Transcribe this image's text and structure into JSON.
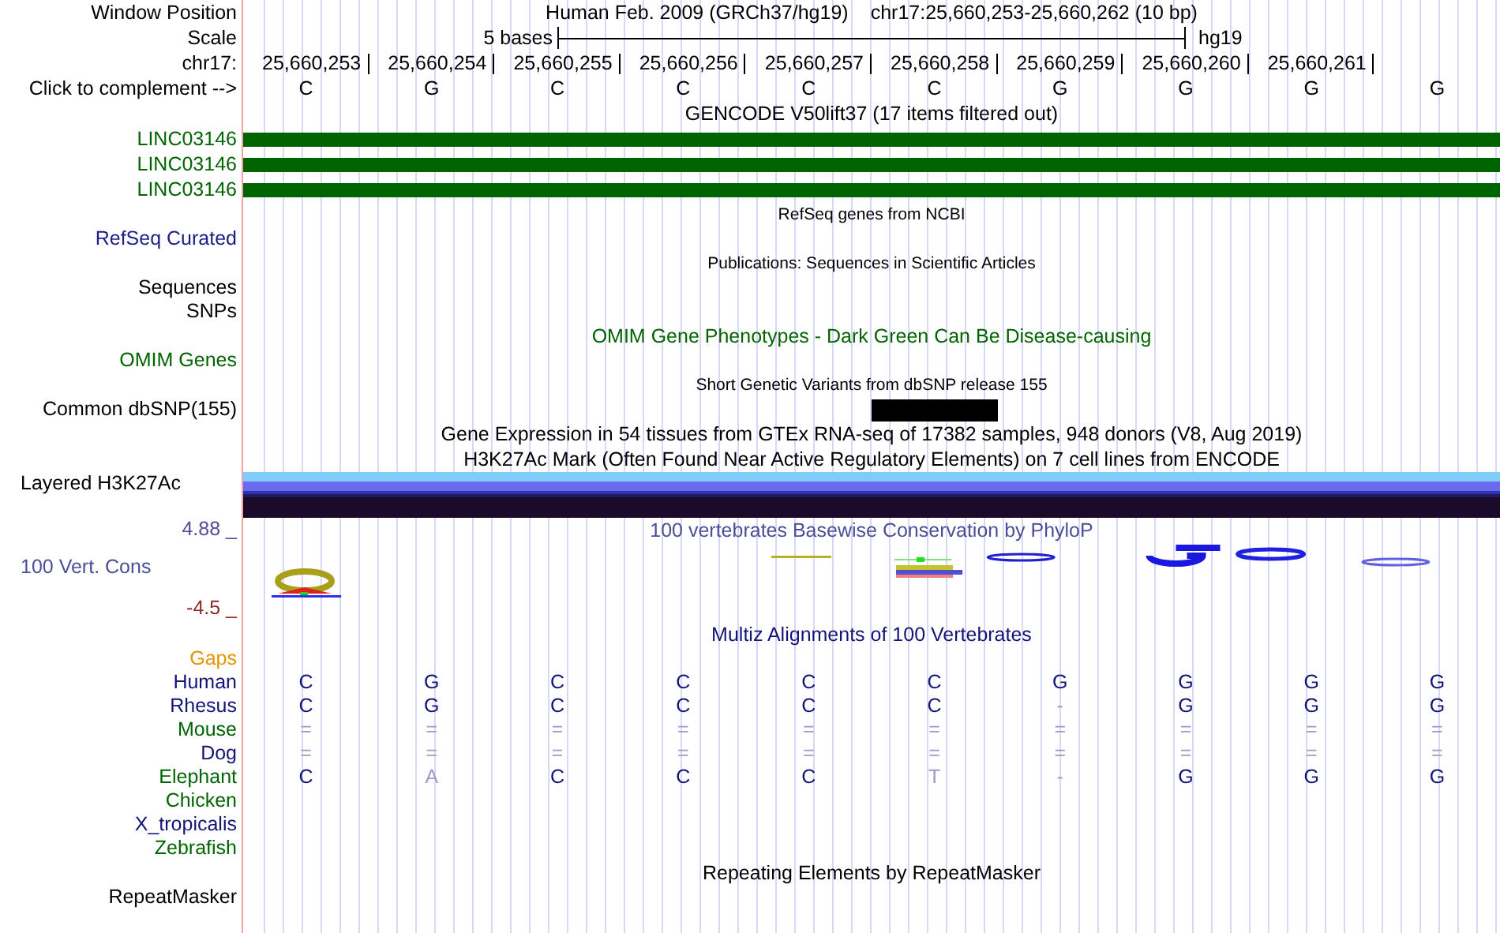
{
  "lines": [
    {
      "kind": "position",
      "label": "Window Position",
      "text": "Human Feb. 2009 (GRCh37/hg19)",
      "range": "chr17:25,660,253-25,660,262 (10 bp)"
    },
    {
      "kind": "scale",
      "label": "Scale",
      "text": "5 bases",
      "assembly": "hg19"
    },
    {
      "kind": "ruler",
      "label": "chr17:",
      "ticks": [
        "25,660,253",
        "25,660,254",
        "25,660,255",
        "25,660,256",
        "25,660,257",
        "25,660,258",
        "25,660,259",
        "25,660,260",
        "25,660,261"
      ]
    },
    {
      "kind": "bases",
      "label": "Click to complement -->",
      "bases": [
        "C",
        "G",
        "C",
        "C",
        "C",
        "C",
        "G",
        "G",
        "G",
        "G"
      ]
    },
    {
      "kind": "title",
      "text": "GENCODE V50lift37 (17 items filtered out)",
      "color": "#000000"
    },
    {
      "kind": "gene",
      "label": "LINC03146",
      "color": "#006400"
    },
    {
      "kind": "gene",
      "label": "LINC03146",
      "color": "#006400"
    },
    {
      "kind": "gene",
      "label": "LINC03146",
      "color": "#006400"
    },
    {
      "kind": "small-title",
      "text": "RefSeq genes from NCBI"
    },
    {
      "kind": "label",
      "label": "RefSeq Curated",
      "color": "#1c1c8a"
    },
    {
      "kind": "small-title",
      "text": "Publications: Sequences in Scientific Articles"
    },
    {
      "kind": "label",
      "label": "Sequences",
      "color": "#000000"
    },
    {
      "kind": "label",
      "label": "SNPs",
      "color": "#000000"
    },
    {
      "kind": "title",
      "text": "OMIM Gene Phenotypes - Dark Green Can Be Disease-causing",
      "color": "#006400"
    },
    {
      "kind": "label",
      "label": "OMIM Genes",
      "color": "#006400"
    },
    {
      "kind": "small-title",
      "text": "Short Genetic Variants from dbSNP release 155"
    },
    {
      "kind": "variants",
      "label": "Common dbSNP(155)",
      "color": "#000000",
      "variant_at_base": [
        false,
        false,
        false,
        false,
        false,
        true,
        false,
        false,
        false,
        false
      ]
    },
    {
      "kind": "title",
      "text": "Gene Expression in 54 tissues from GTEx RNA-seq of 17382 samples, 948 donors (V8, Aug 2019)",
      "color": "#000000"
    },
    {
      "kind": "title",
      "text": "H3K27Ac Mark (Often Found Near Active Regulatory Elements) on 7 cell lines from ENCODE",
      "color": "#000000"
    },
    {
      "kind": "signal",
      "label": "Layered H3K27Ac",
      "color": "#000000"
    },
    {
      "kind": "conservation",
      "title": "100 vertebrates Basewise Conservation by PhyloP",
      "max": "4.88 _",
      "label": "100 Vert. Cons",
      "min": "-4.5 _",
      "color": "#4d4d99"
    },
    {
      "kind": "title",
      "text": "Multiz Alignments of 100 Vertebrates",
      "color": "#141478"
    },
    {
      "kind": "label",
      "label": "Gaps",
      "color": "#e69500"
    },
    {
      "kind": "alignment",
      "label": "Human",
      "color": "#141478",
      "bases": [
        {
          "text": "C",
          "faded": false
        },
        {
          "text": "G",
          "faded": false
        },
        {
          "text": "C",
          "faded": false
        },
        {
          "text": "C",
          "faded": false
        },
        {
          "text": "C",
          "faded": false
        },
        {
          "text": "C",
          "faded": false
        },
        {
          "text": "G",
          "faded": false
        },
        {
          "text": "G",
          "faded": false
        },
        {
          "text": "G",
          "faded": false
        },
        {
          "text": "G",
          "faded": false
        }
      ]
    },
    {
      "kind": "alignment",
      "label": "Rhesus",
      "color": "#141478",
      "bases": [
        {
          "text": "C",
          "faded": false
        },
        {
          "text": "G",
          "faded": false
        },
        {
          "text": "C",
          "faded": false
        },
        {
          "text": "C",
          "faded": false
        },
        {
          "text": "C",
          "faded": false
        },
        {
          "text": "C",
          "faded": false
        },
        {
          "text": "-",
          "faded": true
        },
        {
          "text": "G",
          "faded": false
        },
        {
          "text": "G",
          "faded": false
        },
        {
          "text": "G",
          "faded": false
        }
      ]
    },
    {
      "kind": "alignment",
      "label": "Mouse",
      "color": "#006400",
      "bases": [
        {
          "text": "=",
          "faded": true
        },
        {
          "text": "=",
          "faded": true
        },
        {
          "text": "=",
          "faded": true
        },
        {
          "text": "=",
          "faded": true
        },
        {
          "text": "=",
          "faded": true
        },
        {
          "text": "=",
          "faded": true
        },
        {
          "text": "=",
          "faded": true
        },
        {
          "text": "=",
          "faded": true
        },
        {
          "text": "=",
          "faded": true
        },
        {
          "text": "=",
          "faded": true
        }
      ]
    },
    {
      "kind": "alignment",
      "label": "Dog",
      "color": "#141478",
      "bases": [
        {
          "text": "=",
          "faded": true
        },
        {
          "text": "=",
          "faded": true
        },
        {
          "text": "=",
          "faded": true
        },
        {
          "text": "=",
          "faded": true
        },
        {
          "text": "=",
          "faded": true
        },
        {
          "text": "=",
          "faded": true
        },
        {
          "text": "=",
          "faded": true
        },
        {
          "text": "=",
          "faded": true
        },
        {
          "text": "=",
          "faded": true
        },
        {
          "text": "=",
          "faded": true
        }
      ]
    },
    {
      "kind": "alignment",
      "label": "Elephant",
      "color": "#006400",
      "bases": [
        {
          "text": "C",
          "faded": false
        },
        {
          "text": "A",
          "faded": true
        },
        {
          "text": "C",
          "faded": false
        },
        {
          "text": "C",
          "faded": false
        },
        {
          "text": "C",
          "faded": false
        },
        {
          "text": "T",
          "faded": true
        },
        {
          "text": "-",
          "faded": true
        },
        {
          "text": "G",
          "faded": false
        },
        {
          "text": "G",
          "faded": false
        },
        {
          "text": "G",
          "faded": false
        }
      ]
    },
    {
      "kind": "label",
      "label": "Chicken",
      "color": "#006400"
    },
    {
      "kind": "label",
      "label": "X_tropicalis",
      "color": "#141478"
    },
    {
      "kind": "label",
      "label": "Zebrafish",
      "color": "#006400"
    },
    {
      "kind": "title",
      "text": "Repeating Elements by RepeatMasker",
      "color": "#000000"
    },
    {
      "kind": "label",
      "label": "RepeatMasker",
      "color": "#000000"
    }
  ]
}
